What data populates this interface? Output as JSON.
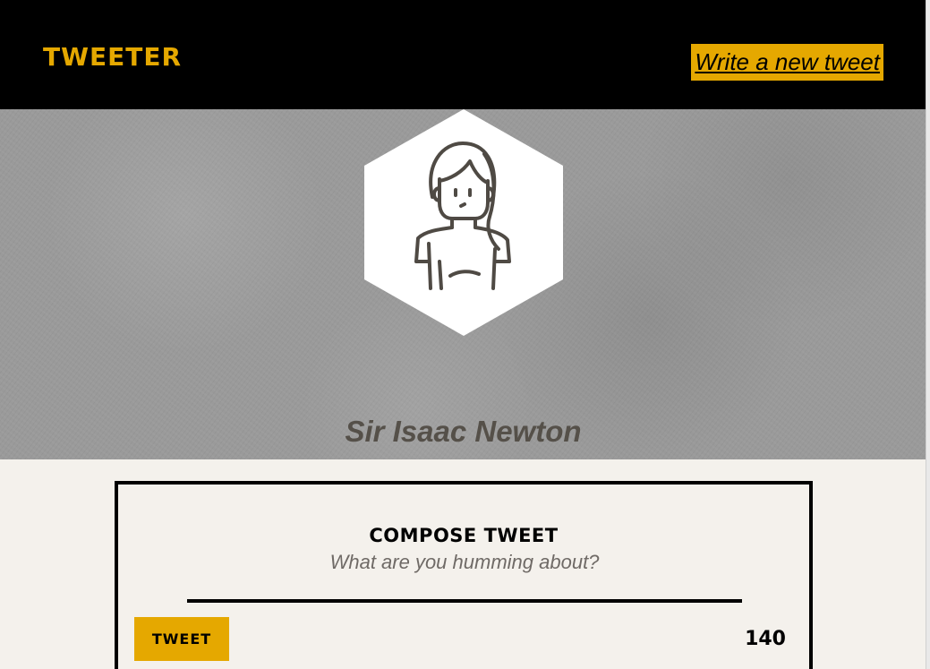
{
  "nav": {
    "brand": "TWEETER",
    "compose_link": "Write a new tweet"
  },
  "profile": {
    "name": "Sir Isaac Newton",
    "avatar_icon": "user-avatar-icon"
  },
  "compose": {
    "title": "Compose Tweet",
    "placeholder": "What are you humming about?",
    "button_label": "Tweet",
    "char_count": "140"
  },
  "colors": {
    "accent": "#e5a800",
    "nav_bg": "#000000",
    "header_bg": "#9a9a9a",
    "page_bg": "#f4f1ec",
    "text_dark": "#555049"
  }
}
